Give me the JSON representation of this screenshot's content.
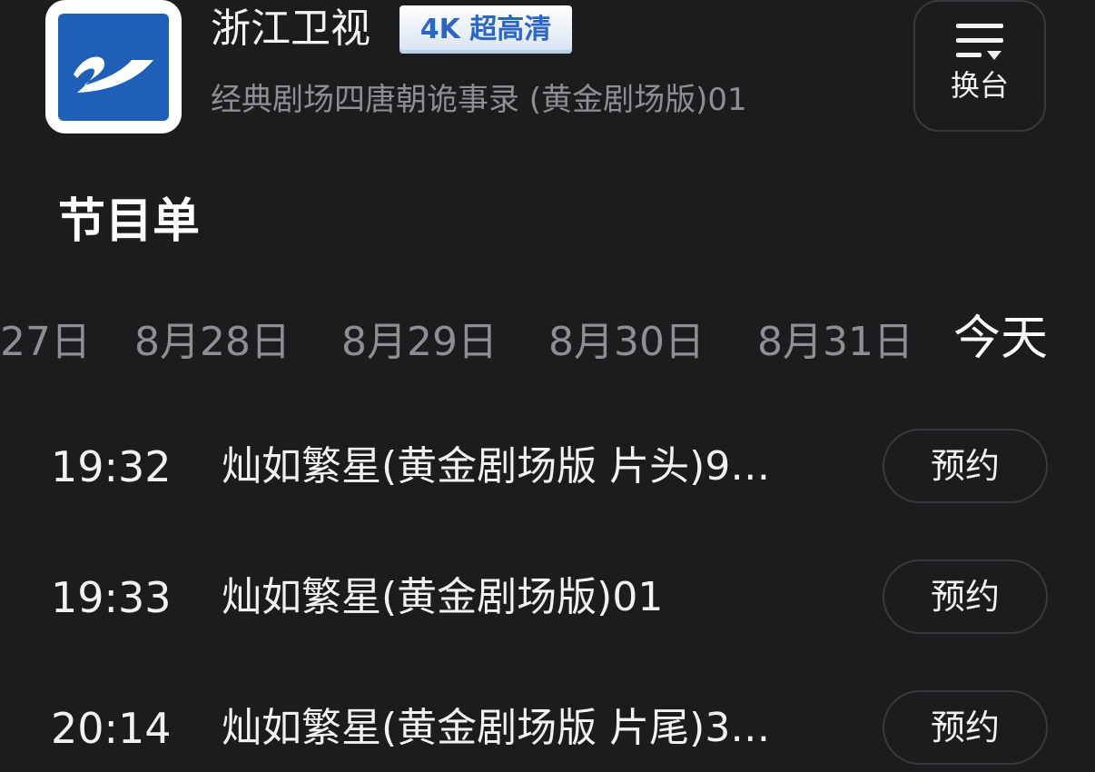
{
  "header": {
    "channel_name": "浙江卫视",
    "badge": "4K 超高清",
    "now_playing": "经典剧场四唐朝诡事录 (黄金剧场版)01",
    "switch_label": "换台",
    "logo_icon": "zhejiang-tv-logo",
    "brand_color": "#1f5fb8"
  },
  "schedule": {
    "title": "节目单",
    "dates": [
      "27日",
      "8月28日",
      "8月29日",
      "8月30日",
      "8月31日",
      "今天"
    ],
    "active_date_index": 5,
    "programs": [
      {
        "time": "19:32",
        "title": "灿如繁星(黄金剧场版 片头)9…",
        "action": "预约"
      },
      {
        "time": "19:33",
        "title": "灿如繁星(黄金剧场版)01",
        "action": "预约"
      },
      {
        "time": "20:14",
        "title": "灿如繁星(黄金剧场版 片尾)3…",
        "action": "预约"
      }
    ]
  },
  "colors": {
    "background": "#1c1c1e",
    "secondary_text": "#8e8e93",
    "badge_text": "#2b67c2"
  }
}
